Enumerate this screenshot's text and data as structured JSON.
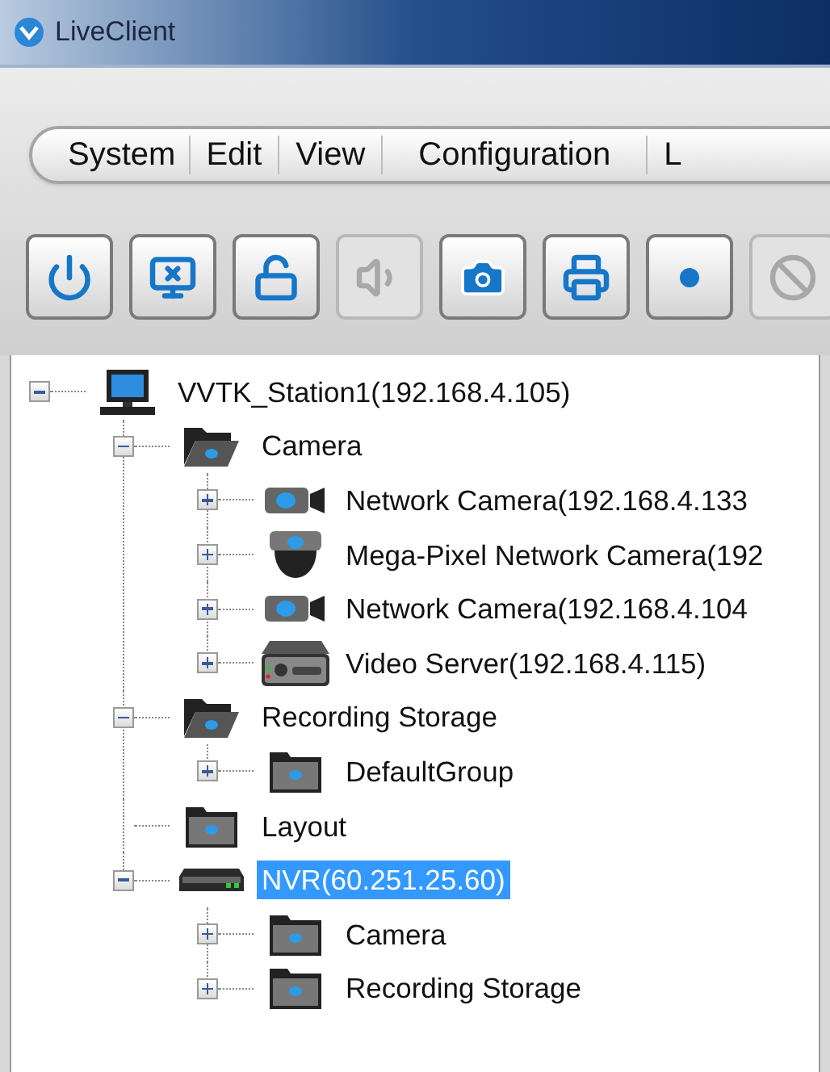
{
  "window": {
    "title": "LiveClient"
  },
  "menu": [
    {
      "label": "System"
    },
    {
      "label": "Edit"
    },
    {
      "label": "View"
    },
    {
      "label": "Configuration"
    },
    {
      "label": "L"
    }
  ],
  "toolbar": [
    {
      "kind": "power",
      "disabled": false
    },
    {
      "kind": "remote",
      "disabled": false
    },
    {
      "kind": "unlock",
      "disabled": false
    },
    {
      "kind": "speaker",
      "disabled": true
    },
    {
      "kind": "snapshot",
      "disabled": false
    },
    {
      "kind": "print",
      "disabled": false
    },
    {
      "kind": "record",
      "disabled": false
    },
    {
      "kind": "stop",
      "disabled": true
    }
  ],
  "tree": [
    {
      "label": "VVTK_Station1(192.168.4.105)",
      "kind": "computer",
      "expandable": true,
      "expanded": true,
      "selected": false,
      "children": [
        {
          "label": "Camera",
          "kind": "open-folder",
          "expandable": true,
          "expanded": true,
          "selected": false,
          "children": [
            {
              "label": "Network Camera(192.168.4.133",
              "kind": "camera",
              "expandable": true,
              "expanded": false,
              "selected": false
            },
            {
              "label": "Mega-Pixel Network Camera(192",
              "kind": "dome",
              "expandable": true,
              "expanded": false,
              "selected": false
            },
            {
              "label": "Network Camera(192.168.4.104",
              "kind": "camera",
              "expandable": true,
              "expanded": false,
              "selected": false
            },
            {
              "label": "Video Server(192.168.4.115)",
              "kind": "server",
              "expandable": true,
              "expanded": false,
              "selected": false
            }
          ]
        },
        {
          "label": "Recording Storage",
          "kind": "open-folder",
          "expandable": true,
          "expanded": true,
          "selected": false,
          "children": [
            {
              "label": "DefaultGroup",
              "kind": "folder",
              "expandable": true,
              "expanded": false,
              "selected": false
            }
          ]
        },
        {
          "label": "Layout",
          "kind": "folder",
          "expandable": false,
          "selected": false
        },
        {
          "label": "NVR(60.251.25.60)",
          "kind": "nvr",
          "expandable": true,
          "expanded": true,
          "selected": true,
          "children": [
            {
              "label": "Camera",
              "kind": "folder",
              "expandable": true,
              "expanded": false,
              "selected": false
            },
            {
              "label": "Recording Storage",
              "kind": "folder",
              "expandable": true,
              "expanded": false,
              "selected": false
            }
          ]
        }
      ]
    }
  ]
}
